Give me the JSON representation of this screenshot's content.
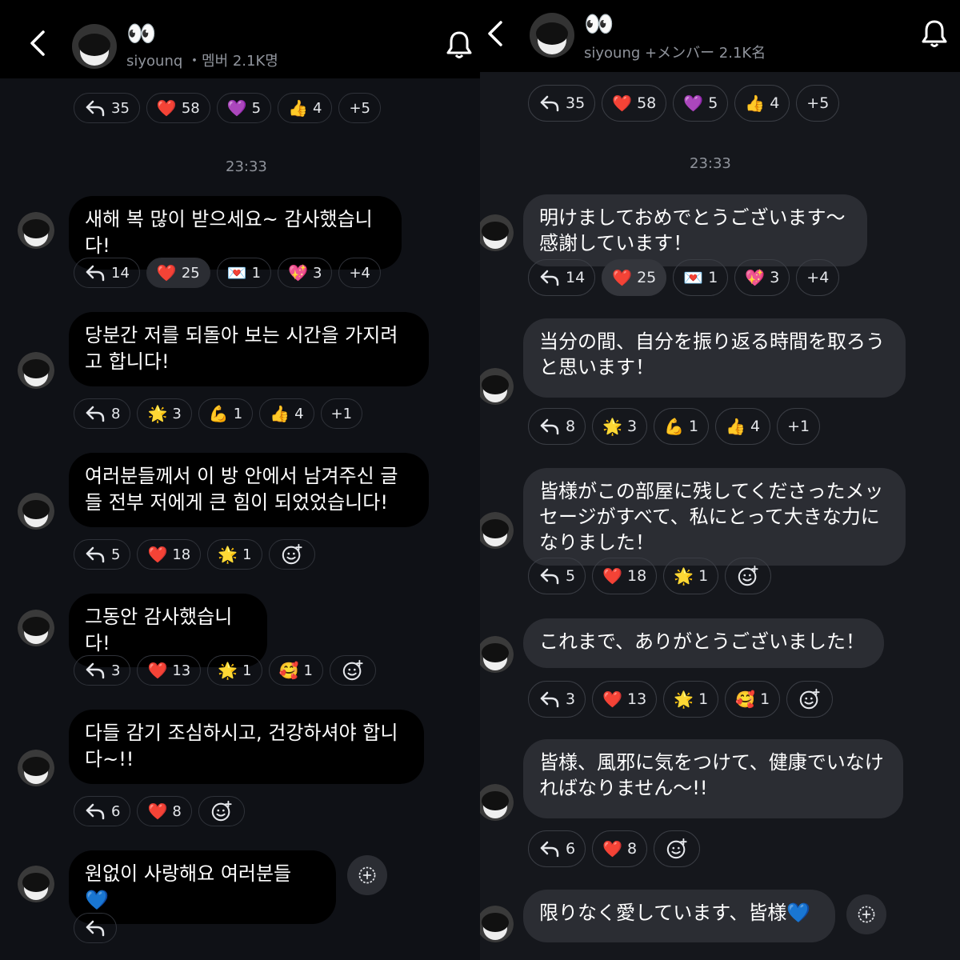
{
  "left": {
    "header": {
      "title": "👀",
      "subtitle": "siyounq ・멤버 2.1K명"
    },
    "time": "23:33",
    "top_reactions": [
      {
        "kind": "reply",
        "count": "35"
      },
      {
        "kind": "emoji",
        "emoji": "❤️",
        "count": "58"
      },
      {
        "kind": "emoji",
        "emoji": "💜",
        "count": "5"
      },
      {
        "kind": "emoji",
        "emoji": "👍",
        "count": "4"
      },
      {
        "kind": "more",
        "count": "+5"
      }
    ],
    "messages": [
      {
        "text": "새해 복 많이 받으세요~ 감사했습니다!",
        "reactions": [
          {
            "kind": "reply",
            "count": "14"
          },
          {
            "kind": "emoji",
            "emoji": "❤️",
            "count": "25",
            "selected": true
          },
          {
            "kind": "emoji",
            "emoji": "💌",
            "count": "1"
          },
          {
            "kind": "emoji",
            "emoji": "💖",
            "count": "3"
          },
          {
            "kind": "more",
            "count": "+4"
          }
        ]
      },
      {
        "text": "당분간 저를 되돌아 보는 시간을 가지려고 합니다!",
        "reactions": [
          {
            "kind": "reply",
            "count": "8"
          },
          {
            "kind": "emoji",
            "emoji": "🌟",
            "count": "3"
          },
          {
            "kind": "emoji",
            "emoji": "💪",
            "count": "1"
          },
          {
            "kind": "emoji",
            "emoji": "👍",
            "count": "4"
          },
          {
            "kind": "more",
            "count": "+1"
          }
        ]
      },
      {
        "text": "여러분들께서 이 방 안에서 남겨주신 글들 전부 저에게 큰 힘이 되었었습니다!",
        "reactions": [
          {
            "kind": "reply",
            "count": "5"
          },
          {
            "kind": "emoji",
            "emoji": "❤️",
            "count": "18"
          },
          {
            "kind": "emoji",
            "emoji": "🌟",
            "count": "1"
          },
          {
            "kind": "add"
          }
        ]
      },
      {
        "text": "그동안 감사했습니다!",
        "reactions": [
          {
            "kind": "reply",
            "count": "3"
          },
          {
            "kind": "emoji",
            "emoji": "❤️",
            "count": "13"
          },
          {
            "kind": "emoji",
            "emoji": "🌟",
            "count": "1"
          },
          {
            "kind": "emoji",
            "emoji": "🥰",
            "count": "1"
          },
          {
            "kind": "add"
          }
        ]
      },
      {
        "text": "다들 감기 조심하시고, 건강하셔야 합니다~!!",
        "reactions": [
          {
            "kind": "reply",
            "count": "6"
          },
          {
            "kind": "emoji",
            "emoji": "❤️",
            "count": "8"
          },
          {
            "kind": "add"
          }
        ]
      },
      {
        "text": "원없이 사랑해요 여러분들 💙",
        "reactions": [
          {
            "kind": "reply",
            "count": ""
          }
        ]
      }
    ]
  },
  "right": {
    "header": {
      "title": "👀",
      "subtitle": "siyoung +メンバー 2.1K名"
    },
    "time": "23:33",
    "top_reactions": [
      {
        "kind": "reply",
        "count": "35"
      },
      {
        "kind": "emoji",
        "emoji": "❤️",
        "count": "58"
      },
      {
        "kind": "emoji",
        "emoji": "💜",
        "count": "5"
      },
      {
        "kind": "emoji",
        "emoji": "👍",
        "count": "4"
      },
      {
        "kind": "more",
        "count": "+5"
      }
    ],
    "messages": [
      {
        "text": "明けましておめでとうございます〜感謝しています！",
        "reactions": [
          {
            "kind": "reply",
            "count": "14"
          },
          {
            "kind": "emoji",
            "emoji": "❤️",
            "count": "25",
            "selected": true
          },
          {
            "kind": "emoji",
            "emoji": "💌",
            "count": "1"
          },
          {
            "kind": "emoji",
            "emoji": "💖",
            "count": "3"
          },
          {
            "kind": "more",
            "count": "+4"
          }
        ]
      },
      {
        "text": "当分の間、自分を振り返る時間を取ろうと思います！",
        "reactions": [
          {
            "kind": "reply",
            "count": "8"
          },
          {
            "kind": "emoji",
            "emoji": "🌟",
            "count": "3"
          },
          {
            "kind": "emoji",
            "emoji": "💪",
            "count": "1"
          },
          {
            "kind": "emoji",
            "emoji": "👍",
            "count": "4"
          },
          {
            "kind": "more",
            "count": "+1"
          }
        ]
      },
      {
        "text": "皆様がこの部屋に残してくださったメッセージがすべて、私にとって大きな力になりました！",
        "reactions": [
          {
            "kind": "reply",
            "count": "5"
          },
          {
            "kind": "emoji",
            "emoji": "❤️",
            "count": "18"
          },
          {
            "kind": "emoji",
            "emoji": "🌟",
            "count": "1"
          },
          {
            "kind": "add"
          }
        ]
      },
      {
        "text": "これまで、ありがとうございました！",
        "reactions": [
          {
            "kind": "reply",
            "count": "3"
          },
          {
            "kind": "emoji",
            "emoji": "❤️",
            "count": "13"
          },
          {
            "kind": "emoji",
            "emoji": "🌟",
            "count": "1"
          },
          {
            "kind": "emoji",
            "emoji": "🥰",
            "count": "1"
          },
          {
            "kind": "add"
          }
        ]
      },
      {
        "text": "皆様、風邪に気をつけて、健康でいなければなりません〜!!",
        "reactions": [
          {
            "kind": "reply",
            "count": "6"
          },
          {
            "kind": "emoji",
            "emoji": "❤️",
            "count": "8"
          },
          {
            "kind": "add"
          }
        ]
      },
      {
        "text": "限りなく愛しています、皆様💙",
        "reactions": []
      }
    ]
  }
}
